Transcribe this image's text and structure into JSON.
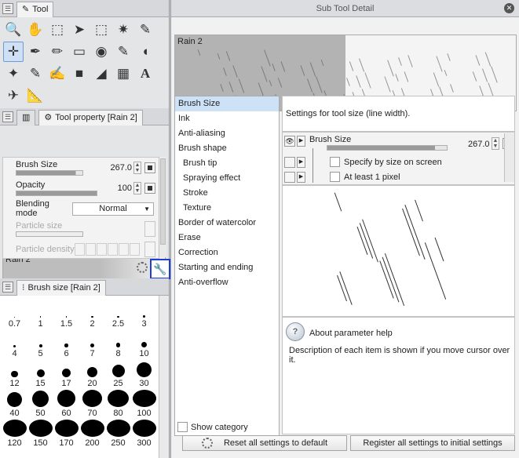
{
  "tool_panel": {
    "tab_label": "Tool"
  },
  "tool_icons": [
    "zoom-icon",
    "hand-icon",
    "rotate-view-icon",
    "object-select-icon",
    "rect-select-icon",
    "auto-select-icon",
    "eyedropper-icon",
    "move-icon",
    "pen-icon",
    "pencil-icon",
    "eraser-icon",
    "fill-bucket-icon",
    "marker-icon",
    "watercolor-icon",
    "airbrush-icon",
    "decoration-icon",
    "blend-icon",
    "gradient-icon",
    "figure-icon",
    "frame-icon",
    "text-icon",
    "balloon-icon",
    "ruler-icon"
  ],
  "tool_property": {
    "tab_label": "Tool property [Rain 2]",
    "brush_name": "Rain 2",
    "brush_size_label": "Brush Size",
    "brush_size_value": "267.0",
    "opacity_label": "Opacity",
    "opacity_value": "100",
    "blending_label": "Blending mode",
    "blending_value": "Normal",
    "particle_size_label": "Particle size",
    "particle_density_label": "Particle density"
  },
  "brush_size_panel": {
    "tab_label": "Brush size [Rain 2]",
    "sizes": [
      "0.7",
      "1",
      "1.5",
      "2",
      "2.5",
      "3",
      "4",
      "5",
      "6",
      "7",
      "8",
      "10",
      "12",
      "15",
      "17",
      "20",
      "25",
      "30",
      "40",
      "50",
      "60",
      "70",
      "80",
      "100",
      "120",
      "150",
      "170",
      "200",
      "250",
      "300"
    ]
  },
  "sub_tool_detail": {
    "title": "Sub Tool Detail",
    "brush_name": "Rain 2",
    "categories": [
      "Brush Size",
      "Ink",
      "Anti-aliasing",
      "Brush shape",
      "Brush tip",
      "Spraying effect",
      "Stroke",
      "Texture",
      "Border of watercolor",
      "Erase",
      "Correction",
      "Starting and ending",
      "Anti-overflow"
    ],
    "selected_category": "Brush Size",
    "settings_description": "Settings for tool size (line width).",
    "brush_size_label": "Brush Size",
    "brush_size_value": "267.0",
    "specify_label": "Specify by size on screen",
    "at_least_label": "At least 1 pixel",
    "help_title": "About parameter help",
    "help_text": "Description of each item is shown if you move cursor over it.",
    "show_category_label": "Show category",
    "reset_label": "Reset all settings to default",
    "register_label": "Register all settings to initial settings"
  },
  "colors": {
    "main_color": "#000000",
    "sub_color": "#ffffff",
    "accent": "#1c3fd6"
  }
}
